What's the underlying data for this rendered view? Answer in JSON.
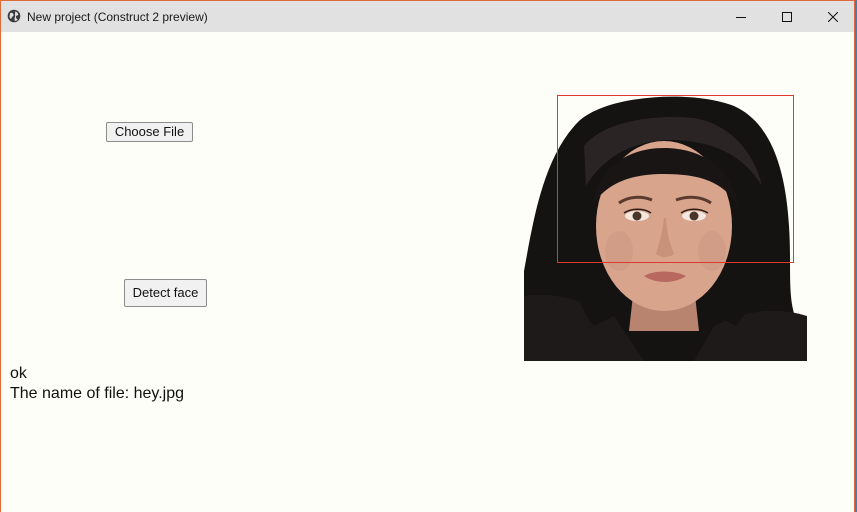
{
  "window": {
    "title": "New project (Construct 2 preview)",
    "icon": "globe-icon",
    "controls": {
      "minimize": "minimize-icon",
      "maximize": "maximize-icon",
      "close": "close-icon"
    }
  },
  "content": {
    "choose_file_label": "Choose File",
    "detect_face_label": "Detect face",
    "status_text": "ok",
    "file_name_text": "The name of file: hey.jpg",
    "image_icon": "portrait-photo",
    "detection_box_color": "#e03a2e"
  },
  "colors": {
    "background": "#fefef8",
    "titlebar": "#e1e1e1",
    "window_border": "#e06b3a"
  }
}
